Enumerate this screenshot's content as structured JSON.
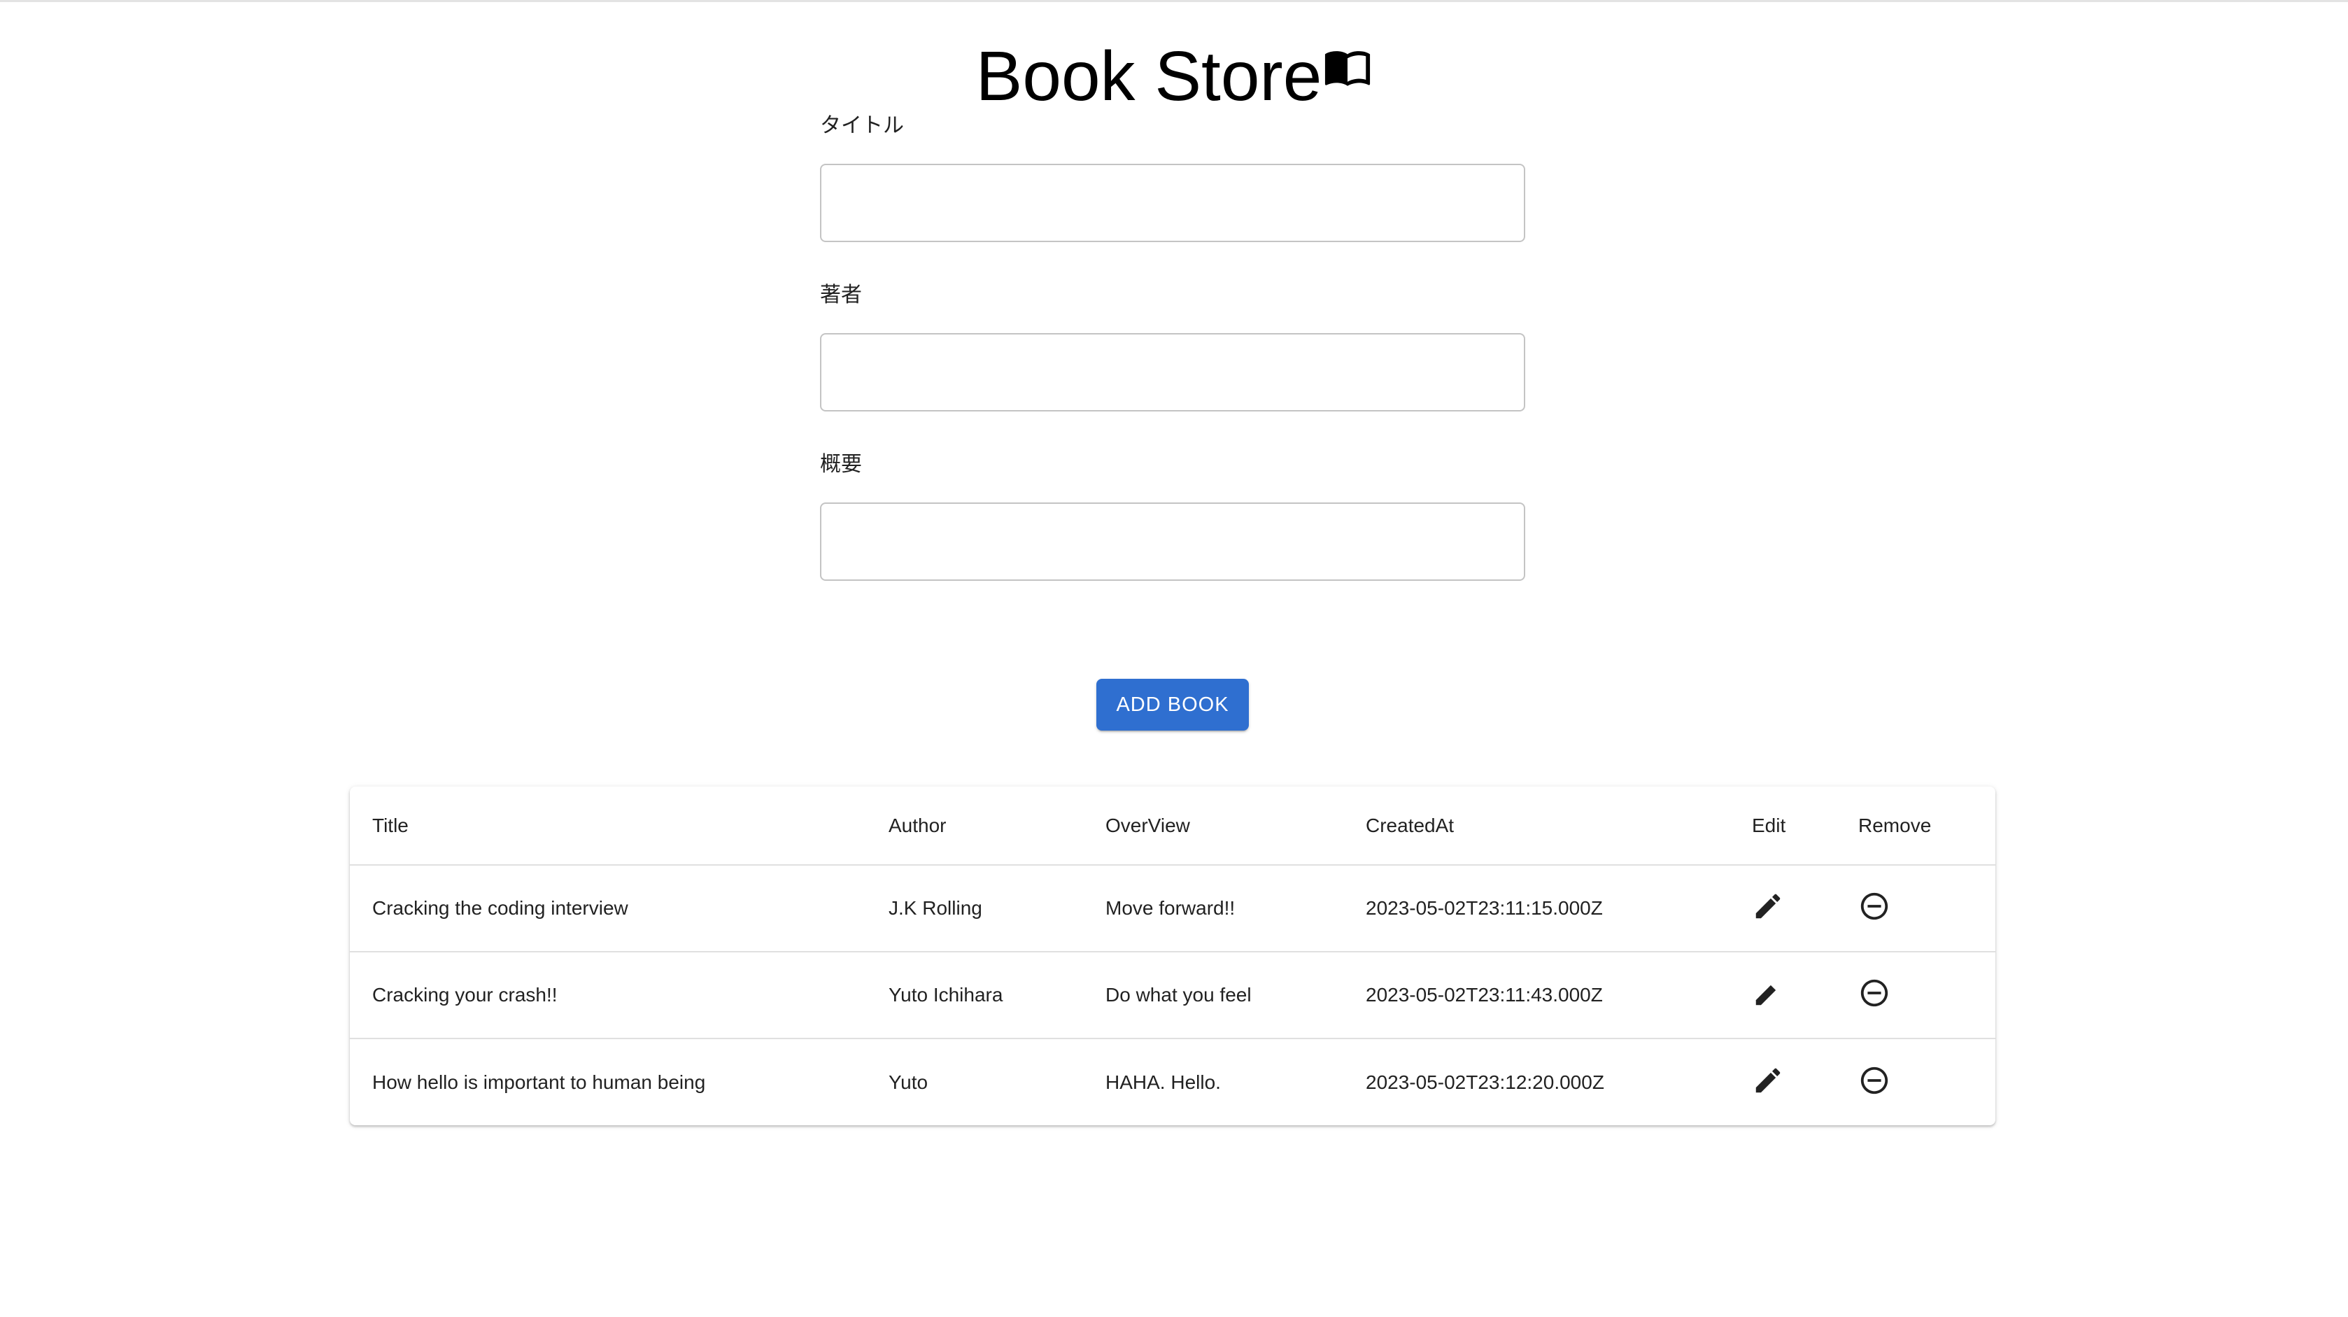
{
  "header": {
    "title": "Book Store"
  },
  "form": {
    "fields": [
      {
        "label": "タイトル",
        "value": "",
        "placeholder": ""
      },
      {
        "label": "著者",
        "value": "",
        "placeholder": ""
      },
      {
        "label": "概要",
        "value": "",
        "placeholder": ""
      }
    ],
    "submit_label": "ADD BOOK"
  },
  "table": {
    "columns": [
      "Title",
      "Author",
      "OverView",
      "CreatedAt",
      "Edit",
      "Remove"
    ],
    "rows": [
      {
        "title": "Cracking the coding interview",
        "author": "J.K Rolling",
        "overview": "Move forward!!",
        "created_at": "2023-05-02T23:11:15.000Z"
      },
      {
        "title": "Cracking your crash!!",
        "author": "Yuto Ichihara",
        "overview": "Do what you feel",
        "created_at": "2023-05-02T23:11:43.000Z"
      },
      {
        "title": "How hello is important to human being",
        "author": "Yuto",
        "overview": "HAHA. Hello.",
        "created_at": "2023-05-02T23:12:20.000Z"
      }
    ]
  },
  "icons": {
    "title": "open-book-icon",
    "edit": "pencil-icon",
    "remove": "remove-circle-outline-icon"
  },
  "colors": {
    "accent": "#2f6fd0",
    "input_border": "#c4c4c4",
    "row_divider": "#e0e0e0"
  }
}
